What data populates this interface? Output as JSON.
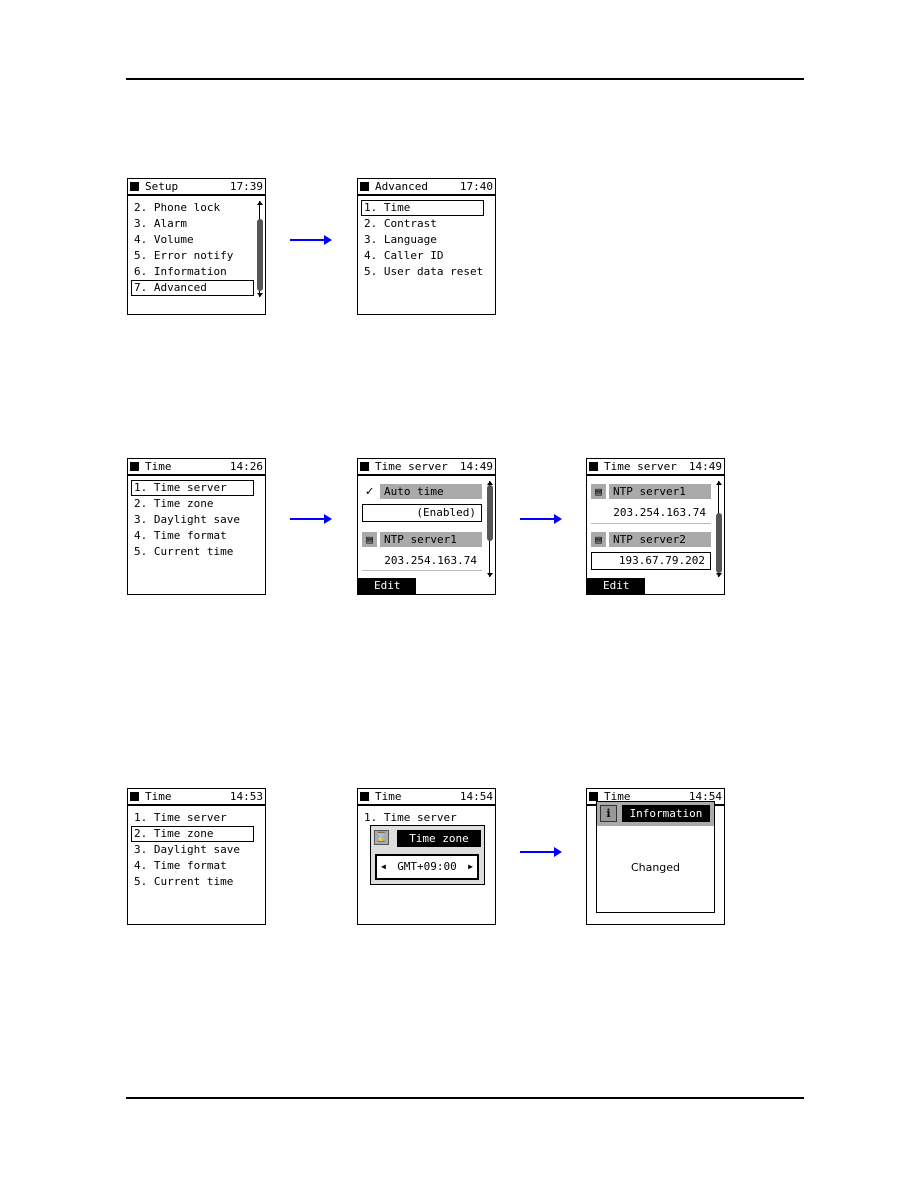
{
  "screens": {
    "setup": {
      "title": "Setup",
      "time": "17:39",
      "items": [
        "2. Phone lock",
        "3. Alarm",
        "4. Volume",
        "5. Error notify",
        "6. Information",
        "7. Advanced"
      ],
      "selected": "7. Advanced"
    },
    "advanced": {
      "title": "Advanced",
      "time": "17:40",
      "items": [
        "1. Time",
        "2. Contrast",
        "3. Language",
        "4. Caller ID",
        "5. User data reset"
      ]
    },
    "time1": {
      "title": "Time",
      "time": "14:26",
      "items": [
        "1. Time server",
        "2. Time zone",
        "3. Daylight save",
        "4. Time format",
        "5. Current time"
      ]
    },
    "timeserver1": {
      "title": "Time server",
      "time": "14:49",
      "auto_label": "Auto time",
      "auto_value": "(Enabled)",
      "ntp1_label": "NTP server1",
      "ntp1_value": "203.254.163.74",
      "softkey": "Edit"
    },
    "timeserver2": {
      "title": "Time server",
      "time": "14:49",
      "ntp1_label": "NTP server1",
      "ntp1_value": "203.254.163.74",
      "ntp2_label": "NTP server2",
      "ntp2_value": "193.67.79.202",
      "softkey": "Edit"
    },
    "time2": {
      "title": "Time",
      "time": "14:53",
      "items": [
        "1. Time server",
        "2. Time zone",
        "3. Daylight save",
        "4. Time format",
        "5. Current time"
      ]
    },
    "time3": {
      "title": "Time",
      "time": "14:54",
      "item1": "1. Time server",
      "dialog_title": "Time zone",
      "dialog_value": "GMT+09:00"
    },
    "time4": {
      "title": "Time",
      "time": "14:54",
      "dialog_title": "Information",
      "dialog_message": "Changed"
    }
  },
  "icons": {
    "checkmark": "check-icon",
    "ntp": "document-icon",
    "timezone": "clock-icon",
    "info": "info-icon"
  },
  "colors": {
    "arrow": "#0000ff",
    "highlight_bar": "#aaaaaa"
  }
}
